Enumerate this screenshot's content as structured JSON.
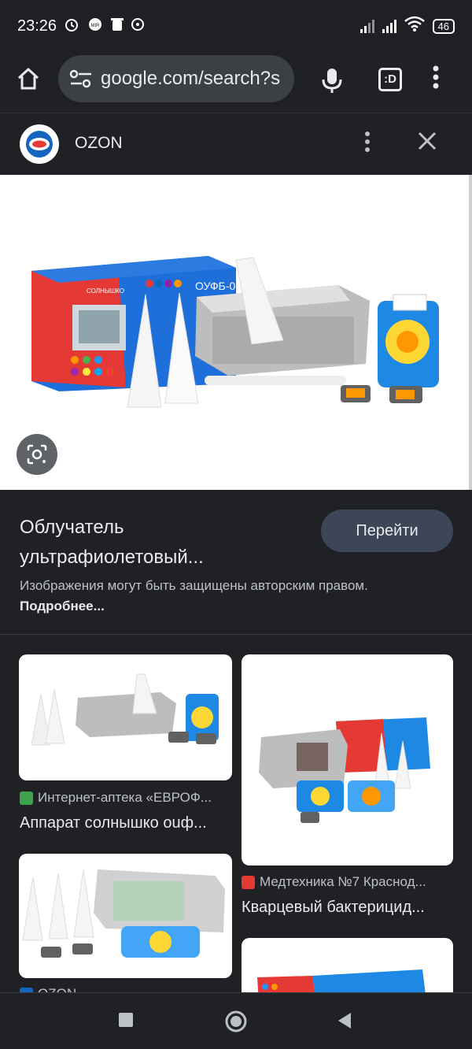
{
  "status_bar": {
    "time": "23:26",
    "battery": "46"
  },
  "browser": {
    "url": "google.com/search?s",
    "tabs_label": ":D"
  },
  "source": {
    "name": "OZON",
    "more_icon": "more-vert-icon",
    "close_icon": "close-icon"
  },
  "preview": {
    "brand_box": "СОЛНЫШКО",
    "model_box": "ОУФБ-0"
  },
  "detail": {
    "title": "Облучатель ультрафиолетовый...",
    "button": "Перейти",
    "notice": "Изображения могут быть защищены авторским правом.",
    "notice_link": "Подробнее..."
  },
  "results": [
    {
      "source": "Интернет-аптека «ЕВРОФ...",
      "title": "Аппарат солнышко ouф...",
      "icon_color": "#3fa34d"
    },
    {
      "source": "Медтехника №7 Краснод...",
      "title": "Кварцевый бактерицид...",
      "icon_color": "#e53935"
    },
    {
      "source": "OZON",
      "title": "",
      "icon_color": "#1565c0"
    }
  ],
  "colors": {
    "bg": "#202124",
    "url_bg": "#3c4043",
    "button_bg": "#3c4657"
  }
}
